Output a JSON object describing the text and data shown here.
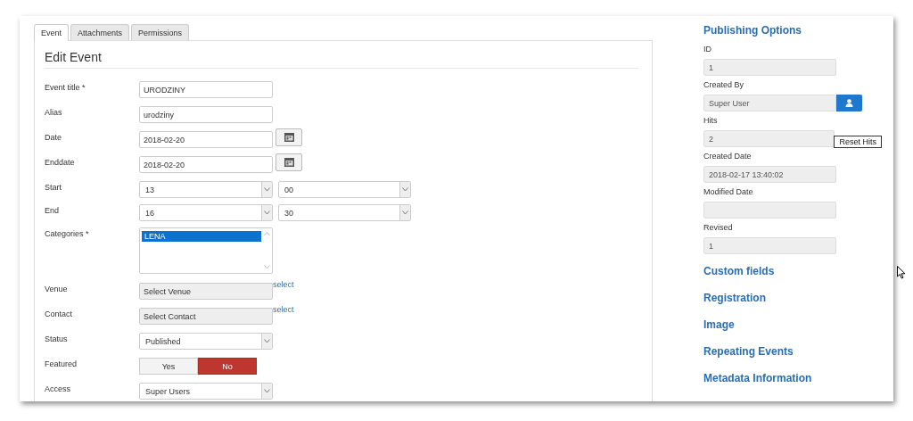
{
  "tabs": [
    {
      "label": "Event",
      "selected": true
    },
    {
      "label": "Attachments",
      "selected": false
    },
    {
      "label": "Permissions",
      "selected": false
    }
  ],
  "form": {
    "title": "Edit Event",
    "fields": [
      {
        "kind": "text",
        "label": "Event title *",
        "value": "URODZINY"
      },
      {
        "kind": "text",
        "label": "Alias",
        "value": "urodziny"
      },
      {
        "kind": "date",
        "label": "Date",
        "value": "2018-02-20"
      },
      {
        "kind": "date",
        "label": "Enddate",
        "value": "2018-02-20"
      },
      {
        "kind": "time",
        "label": "Start",
        "hour": "13",
        "minute": "00"
      },
      {
        "kind": "time",
        "label": "End",
        "hour": "16",
        "minute": "30"
      },
      {
        "kind": "listbox",
        "label": "Categories *",
        "options": [
          {
            "label": "LENA",
            "selected": true
          }
        ]
      },
      {
        "kind": "modal",
        "label": "Venue",
        "value": "Select Venue",
        "link": "select"
      },
      {
        "kind": "modal",
        "label": "Contact",
        "value": "Select Contact",
        "link": "select"
      },
      {
        "kind": "select",
        "label": "Status",
        "value": "Published"
      },
      {
        "kind": "toggle",
        "label": "Featured",
        "options": [
          {
            "label": "Yes",
            "selected": false
          },
          {
            "label": "No",
            "selected": true
          }
        ]
      },
      {
        "kind": "select",
        "label": "Access",
        "value": "Super Users"
      }
    ]
  },
  "sidebar": {
    "heading": "Publishing Options",
    "fields": [
      {
        "kind": "text",
        "label": "ID",
        "value": "1"
      },
      {
        "kind": "user",
        "label": "Created By",
        "value": "Super User"
      },
      {
        "kind": "hits",
        "label": "Hits",
        "value": "2",
        "button": "Reset Hits"
      },
      {
        "kind": "text",
        "label": "Created Date",
        "value": "2018-02-17 13:40:02"
      },
      {
        "kind": "text",
        "label": "Modified Date"
      },
      {
        "kind": "text",
        "label": "Revised",
        "value": "1"
      }
    ],
    "sections": [
      "Custom fields",
      "Registration",
      "Image",
      "Repeating Events",
      "Metadata Information"
    ]
  }
}
